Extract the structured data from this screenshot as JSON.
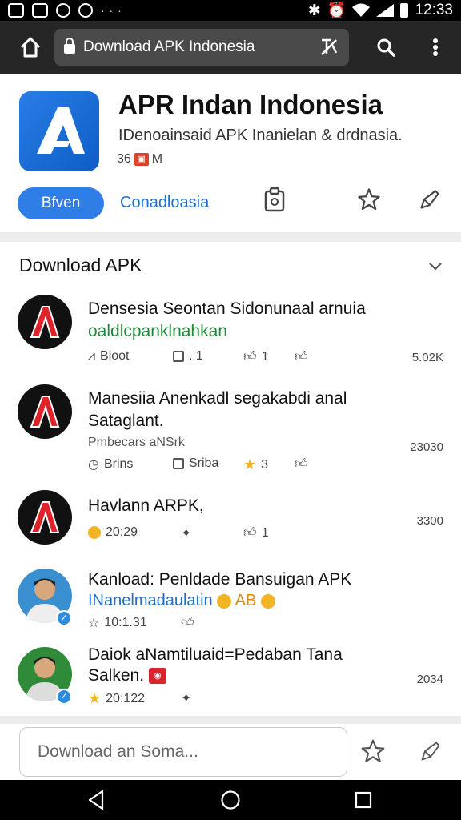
{
  "status_bar": {
    "time": "12:33",
    "dots": "· · ·"
  },
  "toolbar": {
    "url": "Download APK Indonesia"
  },
  "app": {
    "title": "APR Indan Indonesia",
    "subtitle": "IDenoainsaid APK Inanielan & drdnasia.",
    "meta_count": "36",
    "meta_letter": "M",
    "action_label": "Bfven",
    "download_label": "Conadloasia",
    "icon_color": "#2a7de6"
  },
  "section": {
    "title": "Download APK"
  },
  "items": [
    {
      "title_line1": "Densesia Seontan Sidonunaal arnuia",
      "title_line2": "oaldlcpanklnahkan",
      "stat1": "Bloot",
      "stat2": ". 1",
      "stat3": "1",
      "right": "5.02K"
    },
    {
      "title_line1": "Manesiia Anenkadl segakabdi anal",
      "title_line2": "Sataglant.",
      "sub": "Pmbecars aNSrk",
      "stat1": "Brins",
      "stat2": "Sriba",
      "stat3": "3",
      "right": "23030"
    },
    {
      "title_line1": "Havlann ARPK,",
      "stat1": "20:29",
      "stat3": "1",
      "right": "3300"
    },
    {
      "title_line1": "Kanload: Penldade Bansuigan APK",
      "title_line2": "INanelmadaulatin",
      "badge_text": "AB",
      "stat1": "10:1.31"
    },
    {
      "title_line1": "Daiok aNamtiluaid=Pedaban Tana",
      "title_line2": "Salken.",
      "stat1": "20:122",
      "right": "2034"
    }
  ],
  "bottom": {
    "placeholder": "Download an Soma..."
  },
  "colors": {
    "accent": "#2f7de6",
    "toolbar": "#262626",
    "link": "#1a6fd6"
  }
}
